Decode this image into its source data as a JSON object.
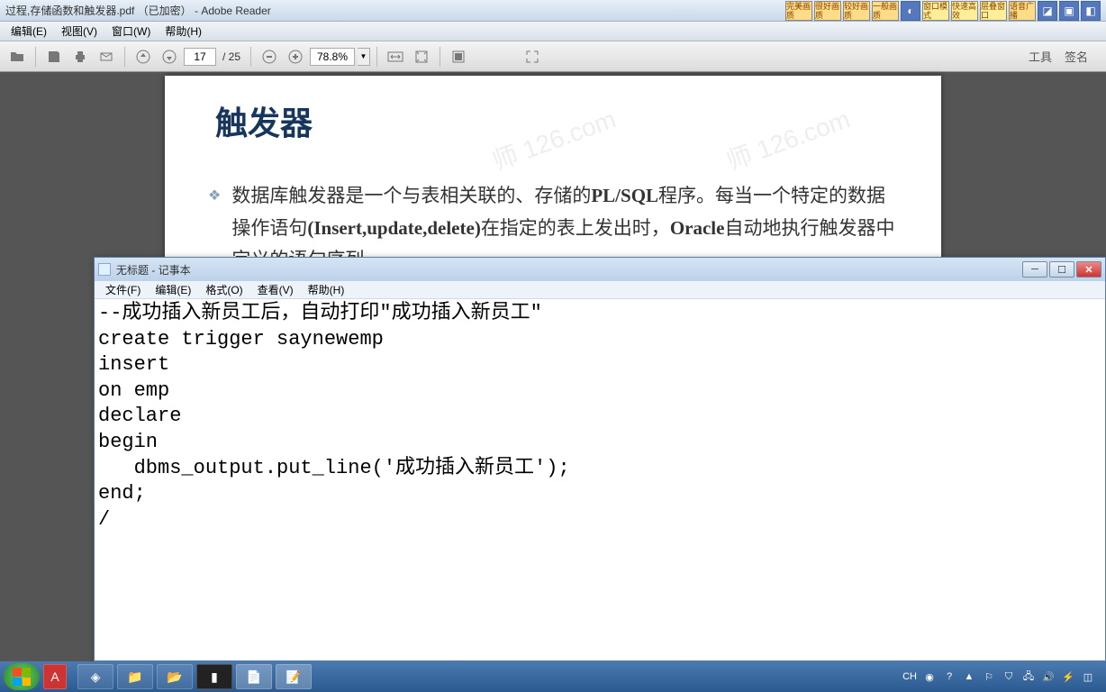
{
  "reader": {
    "title": "过程,存储函数和触发器.pdf （已加密） - Adobe Reader",
    "menus": {
      "edit": "编辑(E)",
      "view": "视图(V)",
      "window": "窗口(W)",
      "help": "帮助(H)"
    },
    "page": {
      "current": "17",
      "total": "/ 25"
    },
    "zoom": "78.8%",
    "tools": "工具",
    "sign": "签名"
  },
  "ext_buttons": {
    "b1": "完美画质",
    "b2": "很好画质",
    "b3": "较好画质",
    "b4": "一般画质",
    "b5": "窗口模式",
    "b6": "快速高效",
    "b7": "层叠窗口",
    "b8": "语音广播"
  },
  "pdf": {
    "heading": "触发器",
    "para": "数据库触发器是一个与表相关联的、存储的PL/SQL程序。每当一个特定的数据操作语句(Insert,update,delete)在指定的表上发出时，Oracle自动地执行触发器中定义的语句序列。"
  },
  "notepad": {
    "title": "无标题 - 记事本",
    "menus": {
      "file": "文件(F)",
      "edit": "编辑(E)",
      "format": "格式(O)",
      "view": "查看(V)",
      "help": "帮助(H)"
    },
    "content": "--成功插入新员工后，自动打印\"成功插入新员工\"\ncreate trigger saynewemp\ninsert\non emp\ndeclare\nbegin\n   dbms_output.put_line('成功插入新员工');\nend;\n/"
  },
  "tray": {
    "ime": "CH"
  }
}
